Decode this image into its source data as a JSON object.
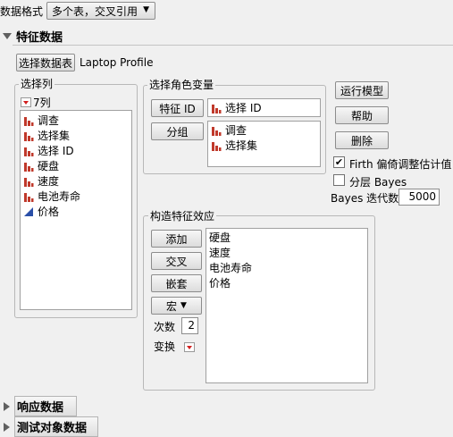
{
  "top": {
    "format_label": "数据格式",
    "format_value": "多个表，交叉引用"
  },
  "feature_section": {
    "title": "特征数据",
    "select_table_button": "选择数据表",
    "table_name": "Laptop Profile",
    "columns_group": {
      "title": "选择列",
      "count_label": "7列",
      "items": [
        "调查",
        "选择集",
        "选择 ID",
        "硬盘",
        "速度",
        "电池寿命",
        "价格"
      ]
    },
    "roles_group": {
      "title": "选择角色变量",
      "feature_id_button": "特征 ID",
      "feature_id_value": "选择 ID",
      "group_button": "分组",
      "group_values": [
        "调查",
        "选择集"
      ]
    },
    "actions": {
      "run": "运行模型",
      "help": "帮助",
      "delete": "删除"
    },
    "firth_label": "Firth 偏倚调整估计值",
    "firth_checked": true,
    "bayes_label": "分层 Bayes",
    "bayes_checked": false,
    "bayes_iter_label": "Bayes 迭代数",
    "bayes_iter_value": "5000",
    "effects_group": {
      "title": "构造特征效应",
      "add": "添加",
      "cross": "交叉",
      "nest": "嵌套",
      "macro": "宏",
      "degree_label": "次数",
      "degree_value": "2",
      "transform_label": "变换",
      "effects": [
        "硬盘",
        "速度",
        "电池寿命",
        "价格"
      ]
    }
  },
  "response_section": {
    "title": "响应数据"
  },
  "subject_section": {
    "title": "测试对象数据"
  },
  "colors": {
    "nominal_icon": "#c0392b",
    "continuous_icon": "#2a4fa8",
    "dropdown_red": "#d21f1f"
  }
}
